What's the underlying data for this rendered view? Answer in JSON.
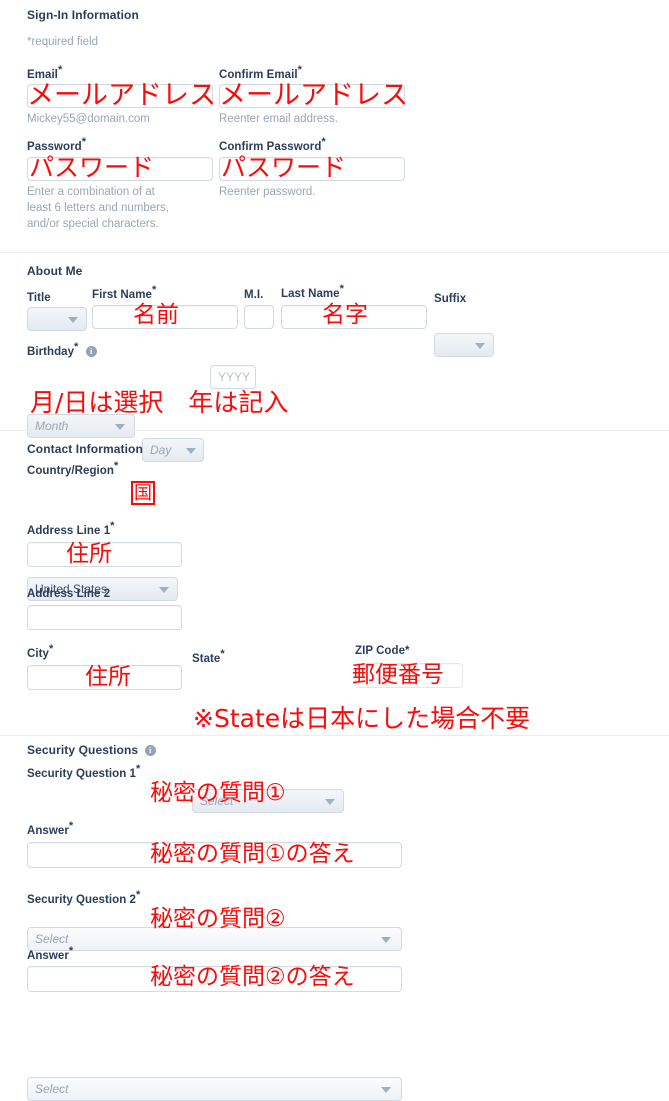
{
  "sections": {
    "signin": {
      "title": "Sign-In Information",
      "required_note": "*required field"
    },
    "about": {
      "title": "About Me"
    },
    "contact": {
      "title": "Contact Information"
    },
    "security": {
      "title": "Security Questions"
    }
  },
  "fields": {
    "email": {
      "label": "Email",
      "required": "*",
      "hint": "Mickey55@domain.com",
      "value": ""
    },
    "confirm_email": {
      "label": "Confirm Email",
      "required": "*",
      "hint": "Reenter email address.",
      "value": ""
    },
    "password": {
      "label": "Password",
      "required": "*",
      "hint": "Enter a combination of at\nleast 6 letters and numbers,\nand/or special characters.",
      "value": ""
    },
    "confirm_password": {
      "label": "Confirm Password",
      "required": "*",
      "hint": "Reenter password.",
      "value": ""
    },
    "title": {
      "label": "Title",
      "value": ""
    },
    "first_name": {
      "label": "First Name",
      "required": "*",
      "value": ""
    },
    "middle_initial": {
      "label": "M.I.",
      "value": ""
    },
    "last_name": {
      "label": "Last Name",
      "required": "*",
      "value": ""
    },
    "suffix": {
      "label": "Suffix",
      "value": ""
    },
    "birthday": {
      "label": "Birthday",
      "required": "*",
      "month_placeholder": "Month",
      "day_placeholder": "Day",
      "year_placeholder": "YYYY"
    },
    "country": {
      "label": "Country/Region",
      "required": "*",
      "value": "United States"
    },
    "address1": {
      "label": "Address Line 1",
      "required": "*",
      "value": ""
    },
    "address2": {
      "label": "Address Line 2",
      "value": ""
    },
    "city": {
      "label": "City",
      "required": "*",
      "value": ""
    },
    "state": {
      "label": "State",
      "required": "*",
      "placeholder": "Select"
    },
    "zip": {
      "label": "ZIP Code*",
      "value": ""
    },
    "security_question_1": {
      "label": "Security Question 1",
      "required": "*",
      "placeholder": "Select"
    },
    "answer_1": {
      "label": "Answer",
      "required": "*",
      "value": ""
    },
    "security_question_2": {
      "label": "Security Question 2",
      "required": "*",
      "placeholder": "Select"
    },
    "answer_2": {
      "label": "Answer",
      "required": "*",
      "value": ""
    }
  },
  "annotations": {
    "email": "メールアドレス",
    "confirm_email": "メールアドレス",
    "password": "パスワード",
    "confirm_password": "パスワード",
    "first_name": "名前",
    "last_name": "名字",
    "birthday": "月/日は選択　年は記入",
    "country": "国",
    "address1": "住所",
    "city": "住所",
    "zip": "郵便番号",
    "state_note": "※Stateは日本にした場合不要",
    "security_question_1": "秘密の質問①",
    "answer_1": "秘密の質問①の答え",
    "security_question_2": "秘密の質問②",
    "answer_2": "秘密の質問②の答え"
  },
  "colors": {
    "annotation_red": "#fb0a0a",
    "label_navy": "#2b3d5b",
    "hint_grey": "#9aa6b4",
    "input_border": "#d3d9e0"
  }
}
